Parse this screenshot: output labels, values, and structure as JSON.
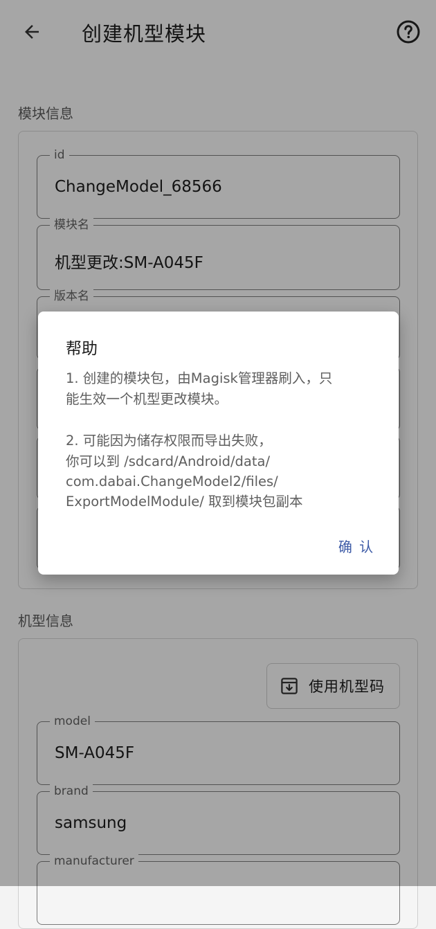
{
  "header": {
    "title": "创建机型模块",
    "back_icon": "arrow-left-icon",
    "help_icon": "help-circle-icon"
  },
  "module_info": {
    "section_label": "模块信息",
    "fields": [
      {
        "label": "id",
        "value": "ChangeModel_68566"
      },
      {
        "label": "模块名",
        "value": "机型更改:SM-A045F"
      },
      {
        "label": "版本名",
        "value": ""
      }
    ]
  },
  "device_info": {
    "section_label": "机型信息",
    "use_code_button": {
      "label": "使用机型码",
      "icon": "import-box-icon"
    },
    "fields": [
      {
        "label": "model",
        "value": "SM-A045F"
      },
      {
        "label": "brand",
        "value": "samsung"
      },
      {
        "label": "manufacturer",
        "value": ""
      }
    ]
  },
  "dialog": {
    "title": "帮助",
    "line1a": "1. 创建的模块包，由Magisk管理器刷入，只",
    "line1b": "能生效一个机型更改模块。",
    "line2a": "2. 可能因为储存权限而导出失败，",
    "line2b": "你可以到 /sdcard/Android/data/",
    "line2c": "com.dabai.ChangeModel2/files/",
    "line2d": "ExportModelModule/ 取到模块包副本",
    "confirm_label": "确 认"
  },
  "colors": {
    "accent": "#3c5aa6",
    "background": "#f5f5f5",
    "scrim": "rgba(0,0,0,0.32)"
  }
}
